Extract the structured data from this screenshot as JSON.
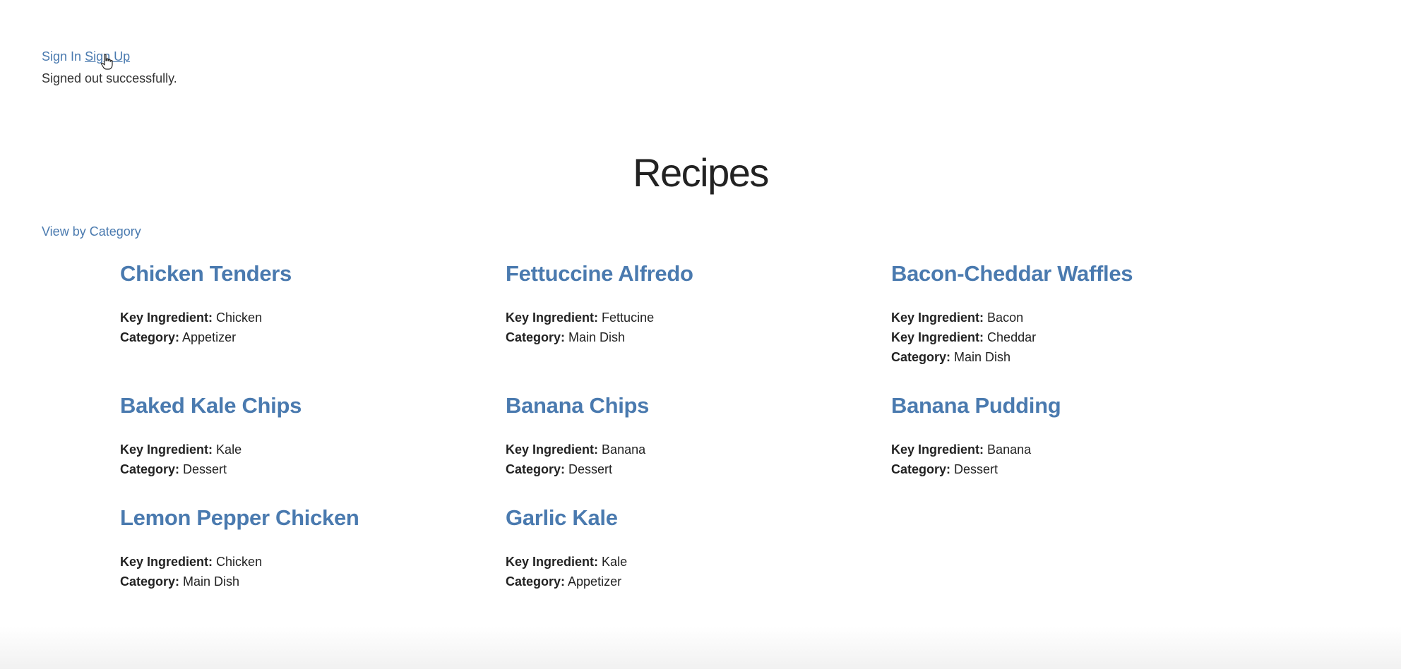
{
  "header": {
    "sign_in_label": "Sign In",
    "sign_up_label": "Sign Up",
    "notice": "Signed out successfully."
  },
  "page_title": "Recipes",
  "view_by_category_label": "View by Category",
  "labels": {
    "key_ingredient": "Key Ingredient:",
    "category": "Category:"
  },
  "recipes": [
    {
      "name": "Chicken Tenders",
      "key_ingredients": [
        "Chicken"
      ],
      "category": "Appetizer"
    },
    {
      "name": "Fettuccine Alfredo",
      "key_ingredients": [
        "Fettucine"
      ],
      "category": "Main Dish"
    },
    {
      "name": "Bacon-Cheddar Waffles",
      "key_ingredients": [
        "Bacon",
        "Cheddar"
      ],
      "category": "Main Dish"
    },
    {
      "name": "Baked Kale Chips",
      "key_ingredients": [
        "Kale"
      ],
      "category": "Dessert"
    },
    {
      "name": "Banana Chips",
      "key_ingredients": [
        "Banana"
      ],
      "category": "Dessert"
    },
    {
      "name": "Banana Pudding",
      "key_ingredients": [
        "Banana"
      ],
      "category": "Dessert"
    },
    {
      "name": "Lemon Pepper Chicken",
      "key_ingredients": [
        "Chicken"
      ],
      "category": "Main Dish"
    },
    {
      "name": "Garlic Kale",
      "key_ingredients": [
        "Kale"
      ],
      "category": "Appetizer"
    }
  ],
  "colors": {
    "link": "#4a7aaf",
    "text": "#222222"
  },
  "icons": {
    "cursor": "hand-pointer-icon"
  }
}
